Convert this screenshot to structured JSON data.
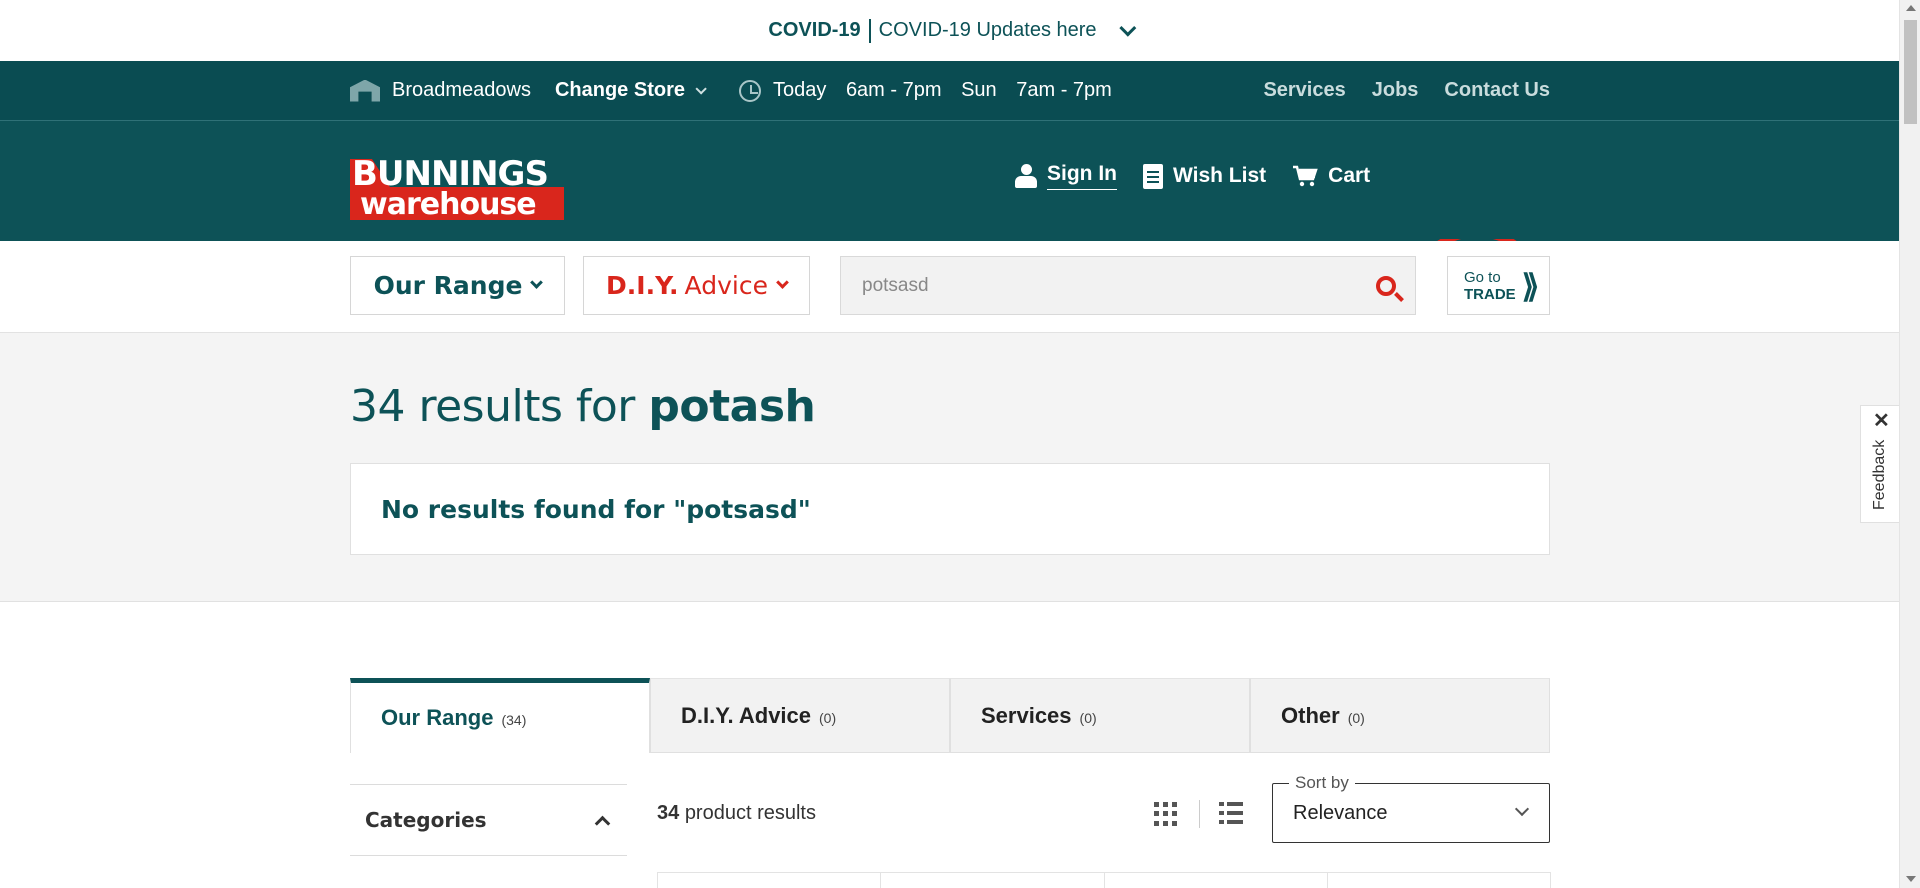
{
  "covid": {
    "label": "COVID-19",
    "link": "COVID-19 Updates here"
  },
  "store_bar": {
    "store_name": "Broadmeadows",
    "change_store": "Change Store",
    "today_label": "Today",
    "today_hours": "6am - 7pm",
    "sun_label": "Sun",
    "sun_hours": "7am - 7pm",
    "links": [
      "Services",
      "Jobs",
      "Contact Us"
    ]
  },
  "header": {
    "logo_top": "BUNNINGS",
    "logo_bottom": "warehouse",
    "sign_in": "Sign In",
    "wish_list": "Wish List",
    "cart": "Cart"
  },
  "nav": {
    "our_range": "Our Range",
    "diy_bold": "D.I.Y.",
    "diy_rest": "Advice",
    "search_value": "potsasd",
    "trade_line1": "Go to",
    "trade_line2": "TRADE"
  },
  "results": {
    "count_prefix": "34 results for",
    "query": "potash",
    "no_results": "No results found for \"potsasd\""
  },
  "tabs": [
    {
      "label": "Our Range",
      "count": "(34)"
    },
    {
      "label": "D.I.Y. Advice",
      "count": "(0)"
    },
    {
      "label": "Services",
      "count": "(0)"
    },
    {
      "label": "Other",
      "count": "(0)"
    }
  ],
  "filters": {
    "categories": "Categories"
  },
  "listing": {
    "product_count": "34",
    "product_count_suffix": "product results",
    "sort_legend": "Sort by",
    "sort_value": "Relevance"
  },
  "feedback": {
    "label": "Feedback",
    "close": "✕"
  },
  "colors": {
    "brand_dark": "#0d5257",
    "brand_red": "#d9261c"
  }
}
